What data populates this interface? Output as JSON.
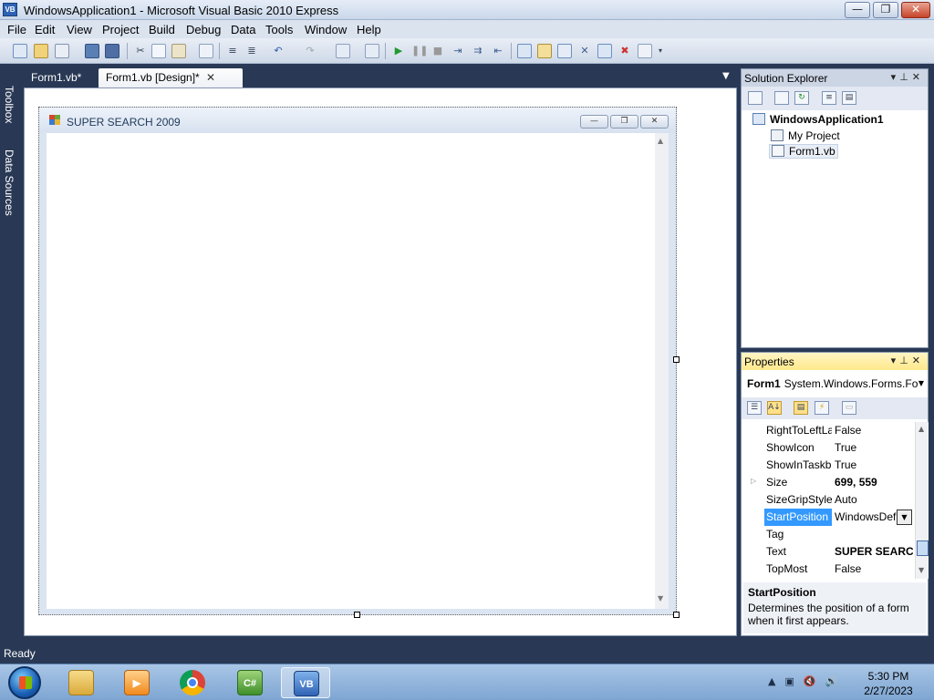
{
  "window": {
    "title": "WindowsApplication1 - Microsoft Visual Basic 2010 Express",
    "app_icon_text": "VB"
  },
  "window_controls": {
    "minimize": "—",
    "maximize": "❐",
    "close": "✕"
  },
  "menu": [
    "File",
    "Edit",
    "View",
    "Project",
    "Build",
    "Debug",
    "Data",
    "Tools",
    "Window",
    "Help"
  ],
  "toolbar": {
    "icons": [
      "new-project-icon",
      "open-file-icon",
      "add-item-icon",
      "save-icon",
      "save-all-icon",
      "cut-icon",
      "copy-icon",
      "paste-icon",
      "find-icon",
      "comment-icon",
      "uncomment-icon",
      "undo-icon",
      "redo-icon",
      "navigate-icon",
      "start-debugging-icon",
      "pause-icon",
      "stop-icon",
      "step-into-icon",
      "step-over-icon",
      "step-out-icon",
      "solution-explorer-icon",
      "properties-icon",
      "object-browser-icon",
      "toolbox-icon",
      "error-list-icon",
      "immediate-icon"
    ]
  },
  "side_strip": {
    "toolbox": "Toolbox",
    "data_sources": "Data Sources"
  },
  "doc_tabs": [
    {
      "label": "Form1.vb*"
    },
    {
      "label": "Form1.vb [Design]*"
    }
  ],
  "form": {
    "title": "SUPER SEARCH 2009",
    "min_glyph": "—",
    "max_glyph": "❐",
    "close_glyph": "✕"
  },
  "solution_explorer": {
    "title": "Solution Explorer",
    "items": [
      {
        "label": "WindowsApplication1",
        "bold": true
      },
      {
        "label": "My Project"
      },
      {
        "label": "Form1.vb"
      }
    ]
  },
  "properties": {
    "title": "Properties",
    "object_name": "Form1",
    "object_type": "System.Windows.Forms.Fo",
    "rows": [
      {
        "name": "RightToLeftLa",
        "value": "False"
      },
      {
        "name": "ShowIcon",
        "value": "True"
      },
      {
        "name": "ShowInTaskb",
        "value": "True"
      },
      {
        "name": "Size",
        "value": "699, 559",
        "expandable": true,
        "bold": true
      },
      {
        "name": "SizeGripStyle",
        "value": "Auto"
      },
      {
        "name": "StartPosition",
        "value": "WindowsDef",
        "selected": true,
        "dropdown": true
      },
      {
        "name": "Tag",
        "value": ""
      },
      {
        "name": "Text",
        "value": "SUPER SEARCH",
        "bold": true
      },
      {
        "name": "TopMost",
        "value": "False"
      }
    ],
    "desc_title": "StartPosition",
    "desc_text": "Determines the position of a form when it first appears."
  },
  "status": {
    "text": "Ready"
  },
  "taskbar": {
    "apps": [
      {
        "name": "windows-explorer"
      },
      {
        "name": "media-player"
      },
      {
        "name": "chrome"
      },
      {
        "name": "visual-csharp",
        "label": "C#"
      },
      {
        "name": "visual-basic",
        "label": "VB",
        "active": true
      }
    ],
    "clock": {
      "time": "5:30 PM",
      "date": "2/27/2023"
    }
  },
  "colors": {
    "ide_background": "#293955",
    "selection": "#3399ff",
    "active_panel_header": "#ffe98c"
  }
}
